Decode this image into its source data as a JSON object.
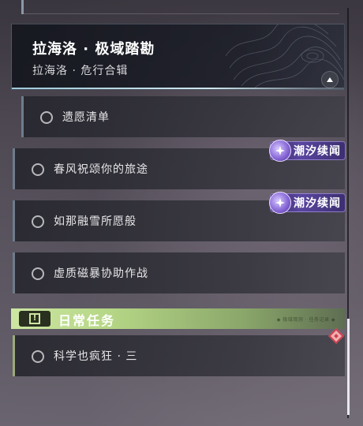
{
  "header": {
    "title": "拉海洛 · 极域踏勘",
    "subtitle": "拉海洛 · 危行合辑"
  },
  "quests": [
    {
      "label": "遗愿清单",
      "badge": ""
    },
    {
      "label": "春风祝颂你的旅途",
      "badge": "潮汐续闻"
    },
    {
      "label": "如那融雪所愿般",
      "badge": "潮汐续闻"
    },
    {
      "label": "虚质磁暴协助作战",
      "badge": ""
    }
  ],
  "daily": {
    "title": "日常任务",
    "icon_glyph": "!",
    "watermark": "◆ 极域观测 · 任务记录 ◆",
    "quests": [
      {
        "label": "科学也疯狂 · 三"
      }
    ]
  },
  "colors": {
    "badge_purple": "#5a46a0",
    "daily_green": "#b5d685",
    "quest_bar": "#6e7c8c",
    "daily_bar": "#9aaa78",
    "track_marker": "#d04050"
  },
  "icons": {
    "collapse": "chevron-up-icon",
    "quest_status": "empty-circle-icon",
    "badge": "tidal-star-icon",
    "daily": "exclamation-icon",
    "track": "track-diamond-icon"
  }
}
